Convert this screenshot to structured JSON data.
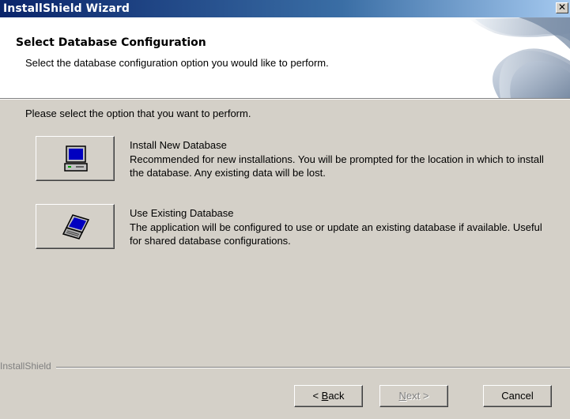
{
  "window": {
    "title": "InstallShield Wizard",
    "close_glyph": "✕"
  },
  "header": {
    "title": "Select Database Configuration",
    "subtitle": "Select the database configuration option you would like to perform."
  },
  "main": {
    "prompt": "Please select the option that you want to perform.",
    "options": [
      {
        "title": "Install New Database",
        "description": "Recommended for new installations.  You will be prompted for the location in which to install the database.  Any existing data will be lost.",
        "icon": "desktop-computer-icon"
      },
      {
        "title": "Use Existing Database",
        "description": "The application will be configured to use or update an existing database if available.  Useful for shared database configurations.",
        "icon": "laptop-computer-icon"
      }
    ]
  },
  "footer": {
    "brand": "InstallShield",
    "back_prefix": "< ",
    "back_mnemonic": "B",
    "back_rest": "ack",
    "next_mnemonic": "N",
    "next_rest": "ext >",
    "cancel_label": "Cancel"
  },
  "colors": {
    "titlebar_start": "#0a246a",
    "titlebar_end": "#a6caf0",
    "dialog_face": "#d4d0c8",
    "header_bg": "#ffffff",
    "disabled_text": "#808080"
  }
}
